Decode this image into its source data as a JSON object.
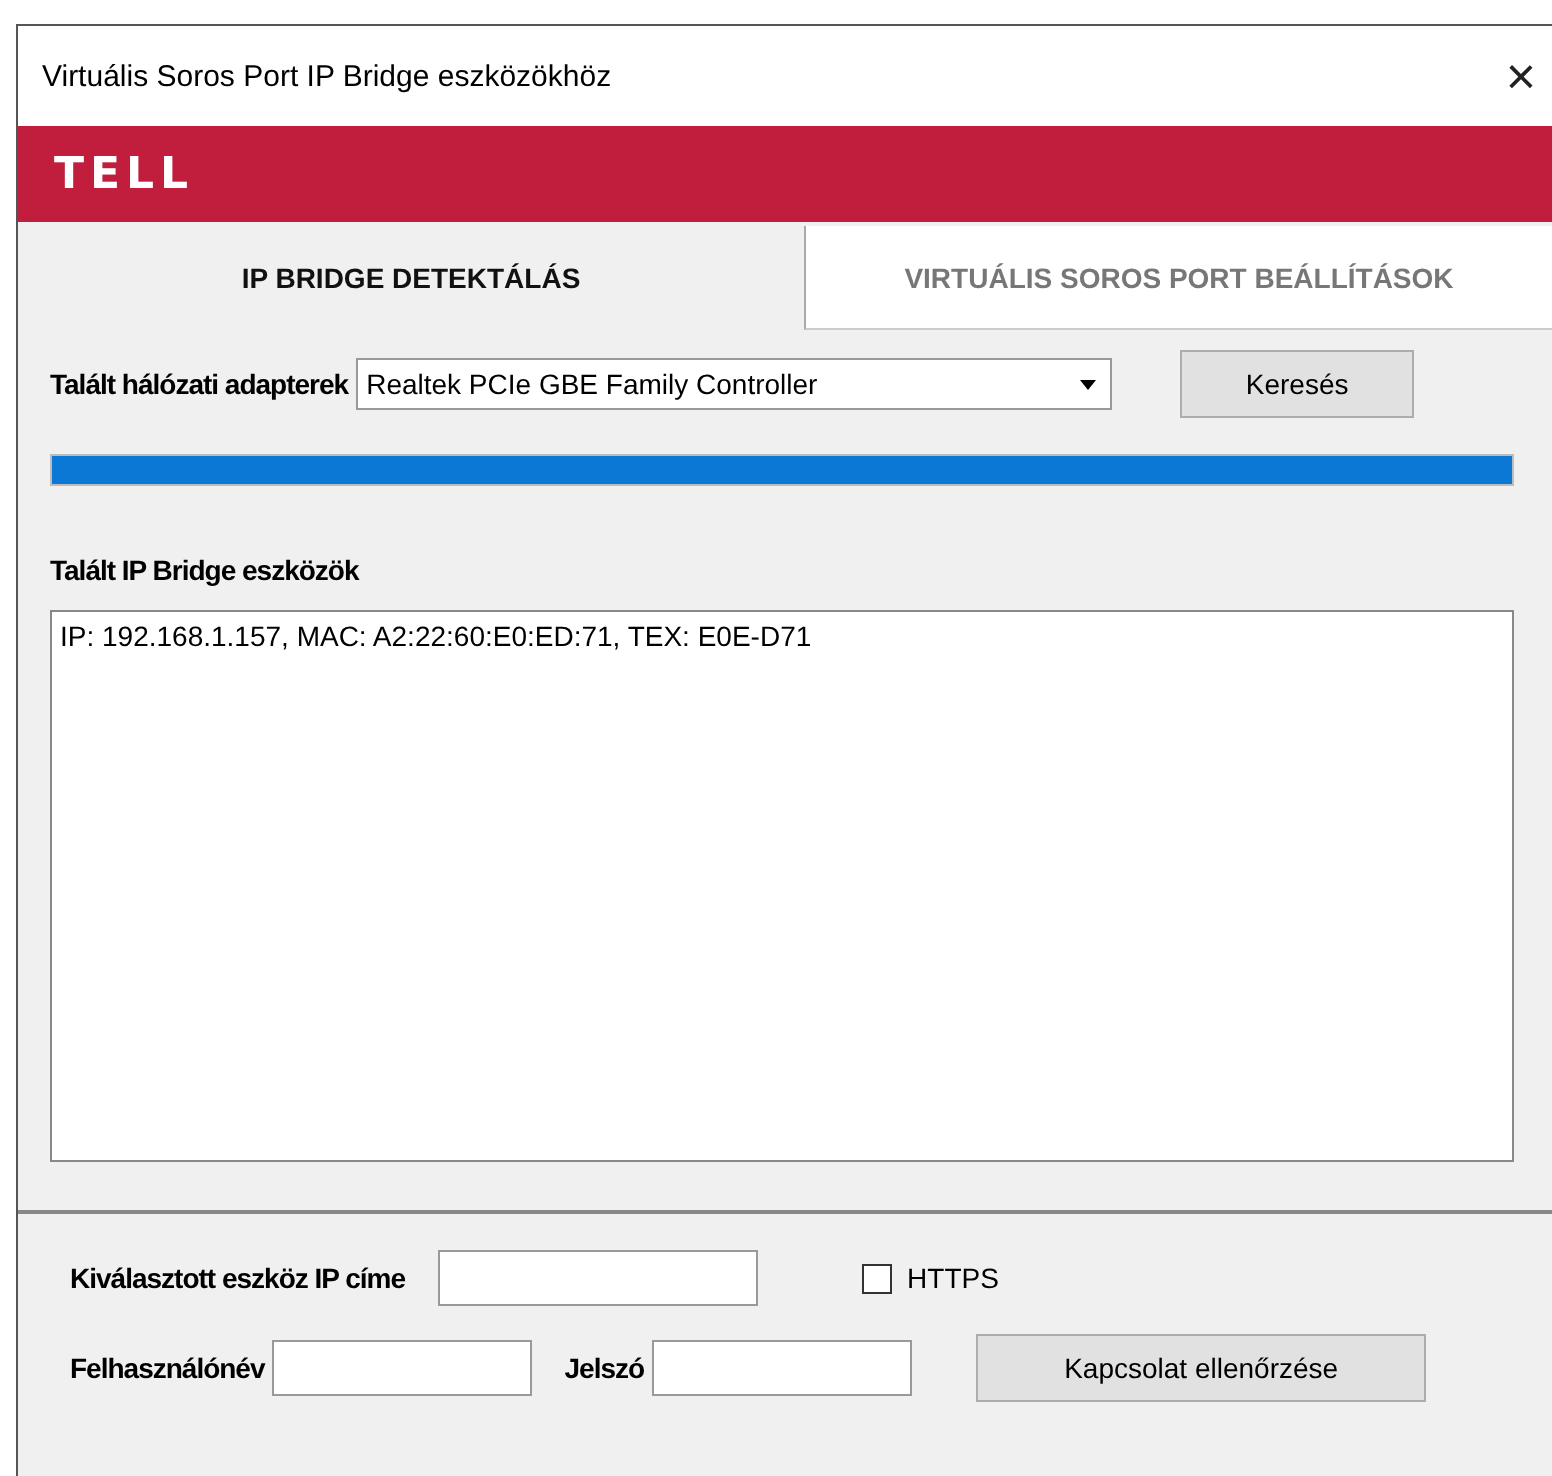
{
  "window": {
    "title": "Virtuális Soros Port IP Bridge eszközökhöz",
    "close": "×"
  },
  "brand": {
    "logo": "TELL"
  },
  "tabs": [
    {
      "label": "IP BRIDGE DETEKTÁLÁS",
      "selected": true
    },
    {
      "label": "VIRTUÁLIS SOROS PORT BEÁLLÍTÁSOK",
      "selected": false
    }
  ],
  "adapter": {
    "label": "Talált hálózati adapterek",
    "value": "Realtek PCIe GBE Family Controller",
    "search_button": "Keresés"
  },
  "progress": {
    "level": 1
  },
  "devices": {
    "label": "Talált IP Bridge eszközök",
    "items": [
      "IP: 192.168.1.157, MAC: A2:22:60:E0:ED:71, TEX: E0E-D71"
    ]
  },
  "connection": {
    "ip_label": "Kiválasztott eszköz IP címe",
    "https": {
      "label": "HTTPS",
      "checked": false
    },
    "user_label": "Felhasználónév",
    "password_label": "Jelszó",
    "check_button": "Kapcsolat ellenőrzése"
  }
}
